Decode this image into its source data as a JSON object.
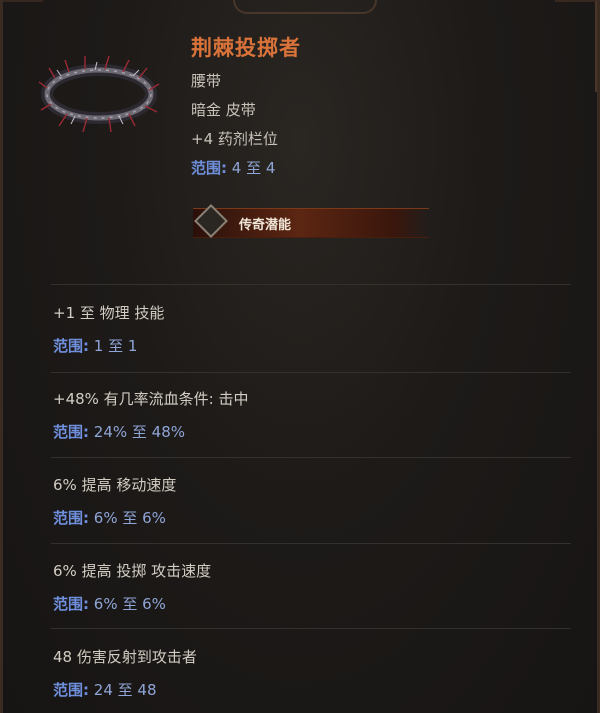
{
  "item": {
    "name": "荆棘投掷者",
    "type": "腰带",
    "subtype": "暗金 皮带",
    "implicit": "+4 药剂栏位",
    "implicit_range_label": "范围:",
    "implicit_range": "4 至 4",
    "icon": "thorn-belt-icon"
  },
  "legend": {
    "label": "传奇潜能",
    "icon": "diamond-icon"
  },
  "affixes": [
    {
      "text": "+1 至 物理 技能",
      "range_label": "范围:",
      "range": "1 至 1"
    },
    {
      "text": "+48% 有几率流血条件:   击中",
      "range_label": "范围:",
      "range": "24% 至 48%"
    },
    {
      "text": "6% 提高 移动速度",
      "range_label": "范围:",
      "range": "6% 至 6%"
    },
    {
      "text": "6% 提高 投掷 攻击速度",
      "range_label": "范围:",
      "range": "6% 至 6%"
    },
    {
      "text": "48 伤害反射到攻击者",
      "range_label": "范围:",
      "range": "24 至 48"
    }
  ],
  "colors": {
    "name": "#d9733a",
    "range_label": "#6f8fdc",
    "range_value": "#8fa5d6",
    "text": "#d2ccc2"
  }
}
